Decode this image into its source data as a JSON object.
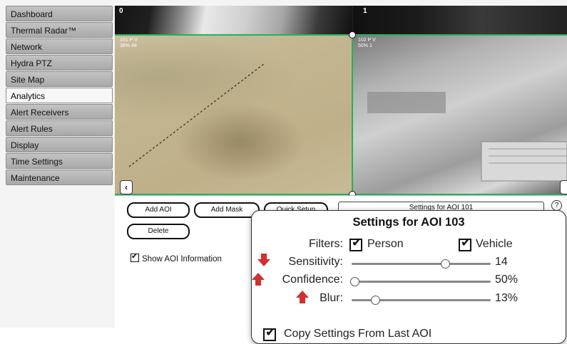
{
  "sidebar": {
    "items": [
      {
        "label": "Dashboard",
        "active": false
      },
      {
        "label": "Thermal Radar™",
        "active": false
      },
      {
        "label": "Network",
        "active": false
      },
      {
        "label": "Hydra PTZ",
        "active": false
      },
      {
        "label": "Site Map",
        "active": false
      },
      {
        "label": "Analytics",
        "active": true
      },
      {
        "label": "Alert Receivers",
        "active": false
      },
      {
        "label": "Alert Rules",
        "active": false
      },
      {
        "label": "Display",
        "active": false
      },
      {
        "label": "Time Settings",
        "active": false
      },
      {
        "label": "Maintenance",
        "active": false
      }
    ]
  },
  "video": {
    "cameras": [
      {
        "number": "0",
        "aoi_tag_line1": "101 P V",
        "aoi_tag_line2": "36% 48"
      },
      {
        "number": "1",
        "aoi_tag_line1": "102 P V",
        "aoi_tag_line2": "50% 1"
      }
    ],
    "prev_icon": "chevron-left-icon",
    "aoi_color": "#1fb35a"
  },
  "toolbar": {
    "add_aoi": "Add AOI",
    "add_mask": "Add Mask",
    "quick_setup": "Quick Setup",
    "delete": "Delete",
    "settings_for": "Settings for AOI 101",
    "help": "?"
  },
  "show_aoi": {
    "label": "Show AOI Information",
    "checked": true
  },
  "callout": {
    "title": "Settings for AOI 103",
    "filters_label": "Filters:",
    "filters": [
      {
        "label": "Person",
        "checked": true
      },
      {
        "label": "Vehicle",
        "checked": true
      }
    ],
    "sliders": [
      {
        "label": "Sensitivity:",
        "value_text": "14",
        "position": 0.67,
        "arrow": "down"
      },
      {
        "label": "Confidence:",
        "value_text": "50%",
        "position": 0.02,
        "arrow": "up"
      },
      {
        "label": "Blur:",
        "value_text": "13%",
        "position": 0.17,
        "arrow": "up"
      }
    ],
    "copy_settings": {
      "label": "Copy Settings From Last AOI",
      "checked": true
    },
    "arrow_color": "#d32f2f"
  }
}
